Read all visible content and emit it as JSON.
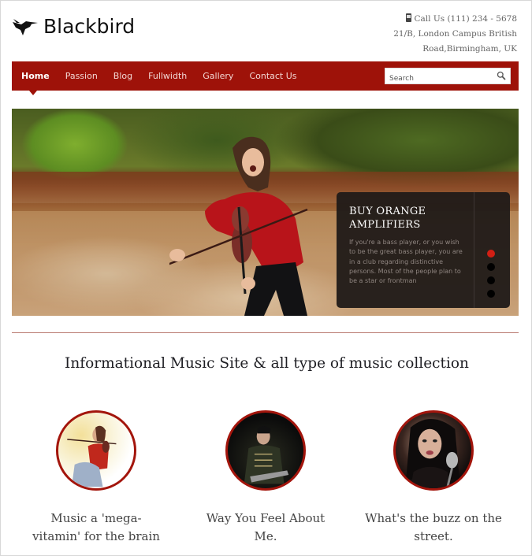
{
  "brand": {
    "name": "Blackbird",
    "logo_icon": "hummingbird-icon"
  },
  "contact": {
    "phone_icon": "mobile-phone-icon",
    "phone": "Call Us (111) 234 - 5678",
    "address_line1": "21/B, London Campus British",
    "address_line2": "Road,Birmingham, UK"
  },
  "nav": {
    "items": [
      {
        "label": "Home",
        "active": true
      },
      {
        "label": "Passion",
        "active": false
      },
      {
        "label": "Blog",
        "active": false
      },
      {
        "label": "Fullwidth",
        "active": false
      },
      {
        "label": "Gallery",
        "active": false
      },
      {
        "label": "Contact Us",
        "active": false
      }
    ],
    "search_placeholder": "Search",
    "search_value": ""
  },
  "slider": {
    "title": "BUY ORANGE AMPLIFIERS",
    "body": "If you're a bass player, or you wish to be the great bass player, you are in a club regarding distinctive persons. Most of the people plan to be a star or frontman",
    "slide_count": 4,
    "active_slide": 1
  },
  "tagline": "Informational Music Site & all type of music collection",
  "features": [
    {
      "title": "Music a 'mega-vitamin' for the brain",
      "image": "violinist-thumbnail"
    },
    {
      "title": "Way You Feel About Me.",
      "image": "guitarist-thumbnail"
    },
    {
      "title": "What's the buzz on the street.",
      "image": "singer-thumbnail"
    }
  ],
  "colors": {
    "brand_red": "#9e1209",
    "active_dot": "#d11f14",
    "caption_bg": "#201a18"
  }
}
